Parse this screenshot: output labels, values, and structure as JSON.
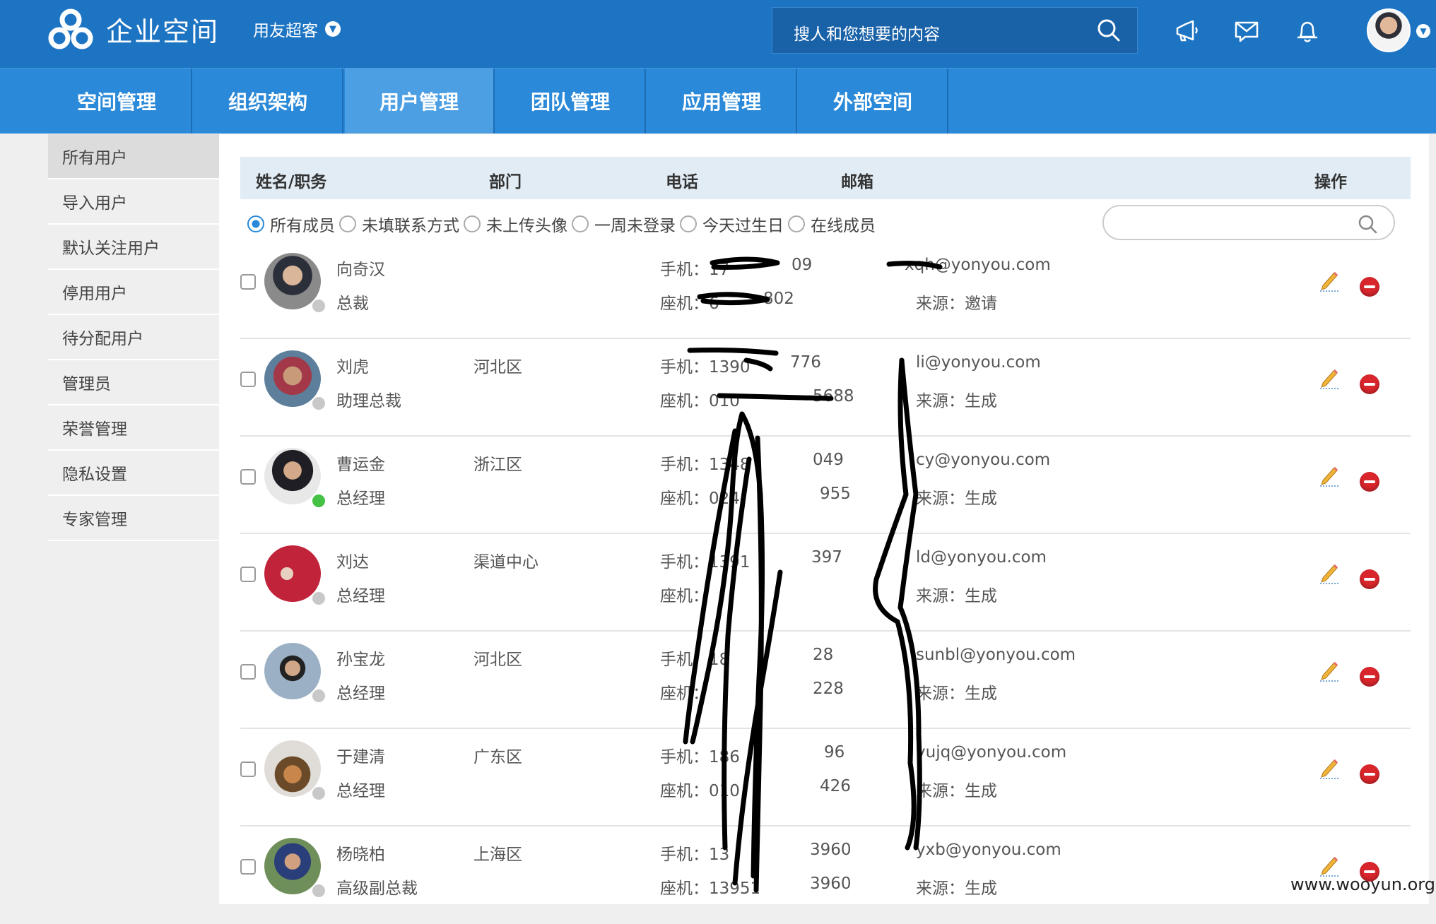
{
  "header": {
    "logo_text": "企业空间",
    "tenant": "用友超客",
    "search_placeholder": "搜人和您想要的内容",
    "colors": {
      "brand": "#1c74c3",
      "nav": "#2a89d8",
      "nav_active": "#4c9fe3",
      "danger": "#d8262c"
    }
  },
  "nav": {
    "items": [
      "空间管理",
      "组织架构",
      "用户管理",
      "团队管理",
      "应用管理",
      "外部空间"
    ],
    "active": "用户管理"
  },
  "sidebar": {
    "items": [
      "所有用户",
      "导入用户",
      "默认关注用户",
      "停用用户",
      "待分配用户",
      "管理员",
      "荣誉管理",
      "隐私设置",
      "专家管理"
    ],
    "active": "所有用户"
  },
  "table": {
    "headers": {
      "name": "姓名/职务",
      "dept": "部门",
      "phone": "电话",
      "email": "邮箱",
      "ops": "操作"
    },
    "filters": [
      "所有成员",
      "未填联系方式",
      "未上传头像",
      "一周未登录",
      "今天过生日",
      "在线成员"
    ],
    "selected_filter": "所有成员",
    "rows": [
      {
        "name": "向奇汉",
        "title": "总裁",
        "dept": "",
        "mobile": "手机：17",
        "mobile_tail": "09",
        "landline": "座机：6",
        "landline_tail": "802",
        "email": "xqh@yonyou.com",
        "source": "来源：邀请",
        "online": false
      },
      {
        "name": "刘虎",
        "title": "助理总裁",
        "dept": "河北区",
        "mobile": "手机：1390",
        "mobile_tail": "776",
        "landline": "座机：010",
        "landline_tail": "5688",
        "email": "li@yonyou.com",
        "source": "来源：生成",
        "online": false
      },
      {
        "name": "曹运金",
        "title": "总经理",
        "dept": "浙江区",
        "mobile": "手机：1348",
        "mobile_tail": "049",
        "landline": "座机：024-",
        "landline_tail": "955",
        "email": "cy@yonyou.com",
        "source": "来源：生成",
        "online": true
      },
      {
        "name": "刘达",
        "title": "总经理",
        "dept": "渠道中心",
        "mobile": "手机：1391",
        "mobile_tail": "397",
        "landline": "座机：",
        "landline_tail": "",
        "email": "ld@yonyou.com",
        "source": "来源：生成",
        "online": false
      },
      {
        "name": "孙宝龙",
        "title": "总经理",
        "dept": "河北区",
        "mobile": "手机：18",
        "mobile_tail": "28",
        "landline": "座机：",
        "landline_tail": "228",
        "email": "sunbl@yonyou.com",
        "source": "来源：生成",
        "online": false
      },
      {
        "name": "于建清",
        "title": "总经理",
        "dept": "广东区",
        "mobile": "手机：186",
        "mobile_tail": "96",
        "landline": "座机：010",
        "landline_tail": "426",
        "email": "yujq@yonyou.com",
        "source": "来源：生成",
        "online": false
      },
      {
        "name": "杨晓柏",
        "title": "高级副总裁",
        "dept": "上海区",
        "mobile": "手机：13",
        "mobile_tail": "3960",
        "landline": "座机：13951",
        "landline_tail": "3960",
        "email": "yxb@yonyou.com",
        "source": "来源：生成",
        "online": false
      }
    ]
  },
  "watermark": "www.wooyun.org"
}
